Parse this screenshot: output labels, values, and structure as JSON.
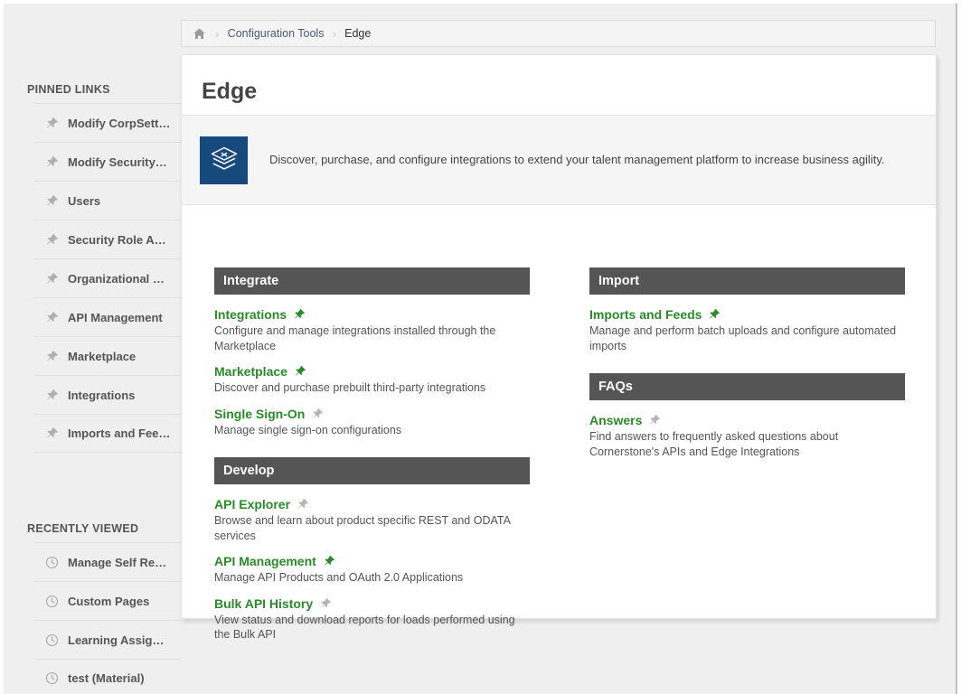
{
  "breadcrumb": {
    "home_icon": "home-icon",
    "separator": "›",
    "items": [
      {
        "label": "Configuration Tools",
        "current": false
      },
      {
        "label": "Edge",
        "current": true
      }
    ]
  },
  "sidebar": {
    "pinned": {
      "heading": "PINNED LINKS",
      "items": [
        {
          "label": "Modify CorpSett…",
          "icon": "pin-icon"
        },
        {
          "label": "Modify Security…",
          "icon": "pin-icon"
        },
        {
          "label": "Users",
          "icon": "pin-icon"
        },
        {
          "label": "Security Role A…",
          "icon": "pin-icon"
        },
        {
          "label": "Organizational …",
          "icon": "pin-icon"
        },
        {
          "label": "API Management",
          "icon": "pin-icon"
        },
        {
          "label": "Marketplace",
          "icon": "pin-icon"
        },
        {
          "label": "Integrations",
          "icon": "pin-icon"
        },
        {
          "label": "Imports and Fee…",
          "icon": "pin-icon"
        }
      ]
    },
    "recent": {
      "heading": "RECENTLY VIEWED",
      "items": [
        {
          "label": "Manage Self Re…",
          "icon": "clock-icon"
        },
        {
          "label": "Custom Pages",
          "icon": "clock-icon"
        },
        {
          "label": "Learning Assig…",
          "icon": "clock-icon"
        },
        {
          "label": "test (Material)",
          "icon": "clock-icon"
        }
      ]
    }
  },
  "page": {
    "title": "Edge",
    "banner": {
      "logo_icon": "edge-layers-icon",
      "logo_color": "#174a7c",
      "description": "Discover, purchase, and configure integrations to extend your talent management platform to increase business agility."
    }
  },
  "colors": {
    "link_green": "#2a8a2a",
    "pin_active": "#2a8a2a",
    "pin_inactive": "#b5b5b5",
    "section_header_bg": "#555555"
  },
  "sections": {
    "left": [
      {
        "header": "Integrate",
        "links": [
          {
            "title": "Integrations",
            "pin_state": "pinned",
            "desc": "Configure and manage integrations installed through the Marketplace"
          },
          {
            "title": "Marketplace",
            "pin_state": "pinned",
            "desc": "Discover and purchase prebuilt third-party integrations"
          },
          {
            "title": "Single Sign-On",
            "pin_state": "unpinned",
            "desc": "Manage single sign-on configurations"
          }
        ]
      },
      {
        "header": "Develop",
        "links": [
          {
            "title": "API Explorer",
            "pin_state": "unpinned",
            "desc": "Browse and learn about product specific REST and ODATA services"
          },
          {
            "title": "API Management",
            "pin_state": "pinned",
            "desc": "Manage API Products and OAuth 2.0 Applications"
          },
          {
            "title": "Bulk API History",
            "pin_state": "unpinned",
            "desc": "View status and download reports for loads performed using the Bulk API"
          }
        ]
      }
    ],
    "right": [
      {
        "header": "Import",
        "links": [
          {
            "title": "Imports and Feeds",
            "pin_state": "pinned",
            "desc": "Manage and perform batch uploads and configure automated imports"
          }
        ]
      },
      {
        "header": "FAQs",
        "links": [
          {
            "title": "Answers",
            "pin_state": "unpinned",
            "desc": "Find answers to frequently asked questions about Cornerstone's APIs and Edge Integrations"
          }
        ]
      }
    ]
  }
}
